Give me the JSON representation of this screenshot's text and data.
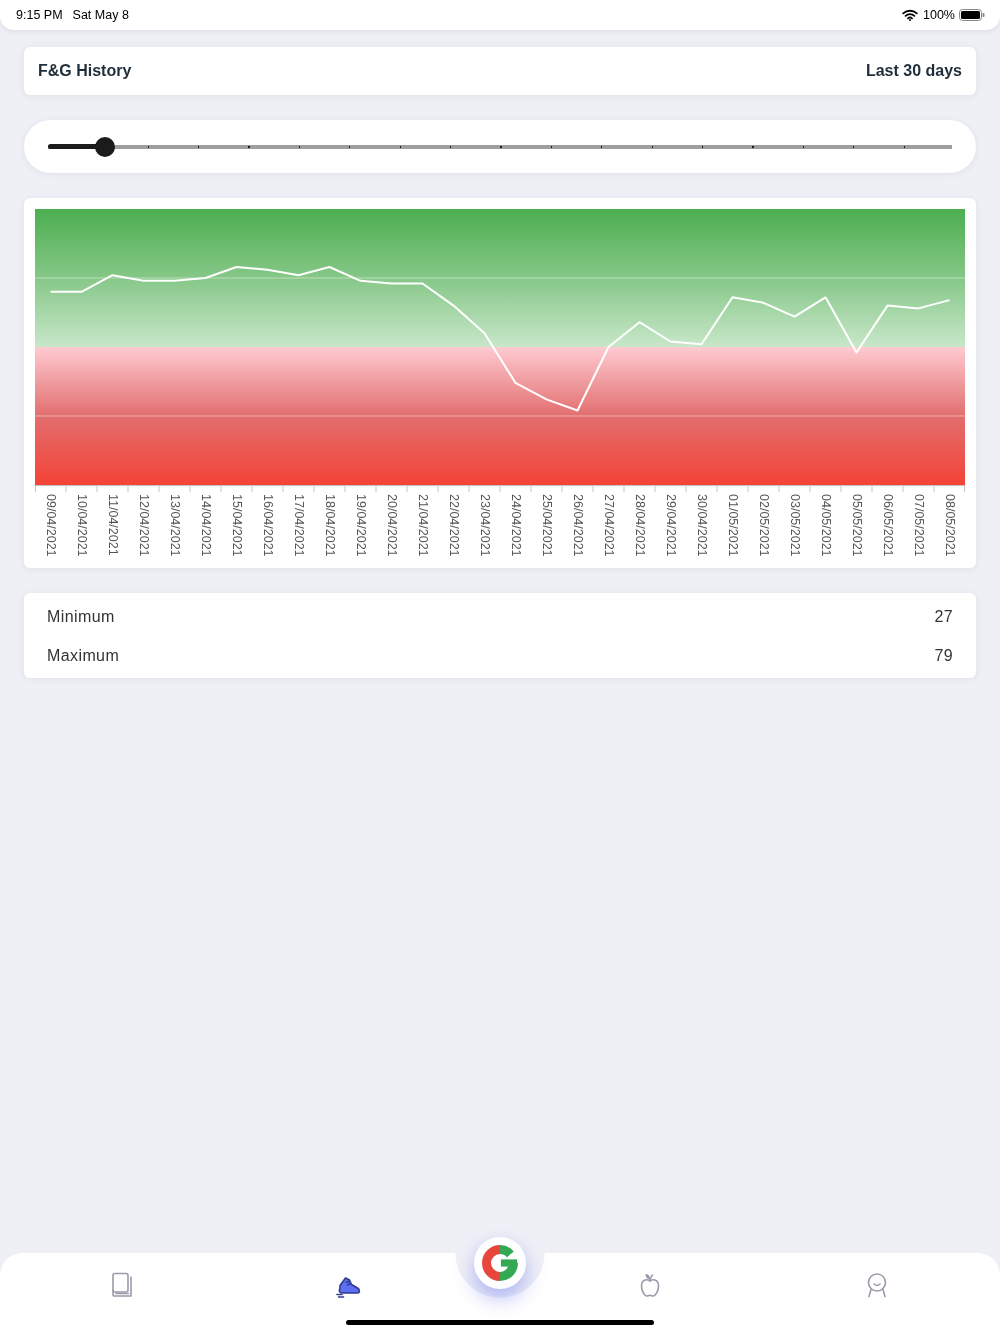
{
  "status_bar": {
    "time": "9:15 PM",
    "date": "Sat May 8",
    "battery": "100%"
  },
  "header": {
    "title": "F&G History",
    "period": "Last 30 days"
  },
  "range_slider": {
    "level": 0.063
  },
  "chart": {
    "dates": [
      "09/04/2021",
      "10/04/2021",
      "11/04/2021",
      "12/04/2021",
      "13/04/2021",
      "14/04/2021",
      "15/04/2021",
      "16/04/2021",
      "17/04/2021",
      "18/04/2021",
      "19/04/2021",
      "20/04/2021",
      "21/04/2021",
      "22/04/2021",
      "23/04/2021",
      "24/04/2021",
      "25/04/2021",
      "26/04/2021",
      "27/04/2021",
      "28/04/2021",
      "29/04/2021",
      "30/04/2021",
      "01/05/2021",
      "02/05/2021",
      "03/05/2021",
      "04/05/2021",
      "05/05/2021",
      "06/05/2021",
      "07/05/2021",
      "08/05/2021"
    ]
  },
  "stats": [
    {
      "label": "Minimum",
      "value": "27"
    },
    {
      "label": "Maximum",
      "value": "79"
    }
  ],
  "tab_bar": {
    "items": [
      {
        "selected": false
      },
      {
        "selected": true
      },
      {
        "selected": false
      },
      {
        "selected": false
      }
    ]
  }
}
